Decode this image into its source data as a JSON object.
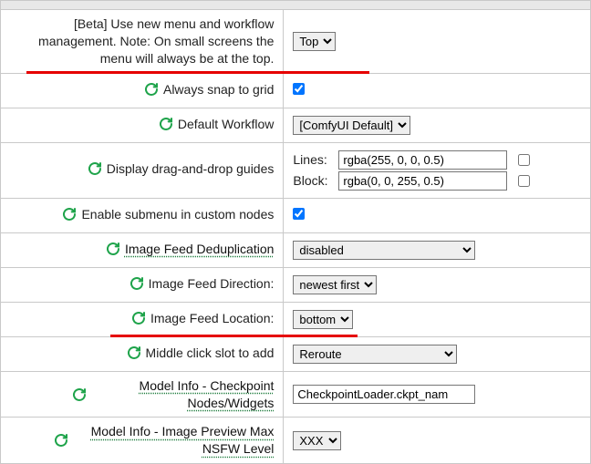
{
  "rows": {
    "beta_menu": {
      "label": "[Beta] Use new menu and workflow management. Note: On small screens the menu will always be at the top.",
      "options": [
        "Top"
      ],
      "value": "Top"
    },
    "snap_grid": {
      "label": "Always snap to grid",
      "checked": true
    },
    "default_workflow": {
      "label": "Default Workflow",
      "options": [
        "[ComfyUI Default]"
      ],
      "value": "[ComfyUI Default]"
    },
    "dnd_guides": {
      "label": "Display drag-and-drop guides",
      "lines_label": "Lines:",
      "lines_value": "rgba(255, 0, 0, 0.5)",
      "lines_checked": false,
      "block_label": "Block:",
      "block_value": "rgba(0, 0, 255, 0.5)",
      "block_checked": false
    },
    "enable_submenu": {
      "label": "Enable submenu in custom nodes",
      "checked": true
    },
    "image_feed_dedup": {
      "label": "Image Feed Deduplication",
      "options": [
        "disabled"
      ],
      "value": "disabled"
    },
    "image_feed_direction": {
      "label": "Image Feed Direction:",
      "options": [
        "newest first"
      ],
      "value": "newest first"
    },
    "image_feed_location": {
      "label": "Image Feed Location:",
      "options": [
        "bottom"
      ],
      "value": "bottom"
    },
    "middle_click_slot": {
      "label": "Middle click slot to add",
      "options": [
        "Reroute"
      ],
      "value": "Reroute"
    },
    "model_info_checkpoint": {
      "label": "Model Info - Checkpoint Nodes/Widgets",
      "value": "CheckpointLoader.ckpt_nam"
    },
    "model_info_nsfw": {
      "label": "Model Info - Image Preview Max NSFW Level",
      "options": [
        "XXX"
      ],
      "value": "XXX"
    }
  }
}
